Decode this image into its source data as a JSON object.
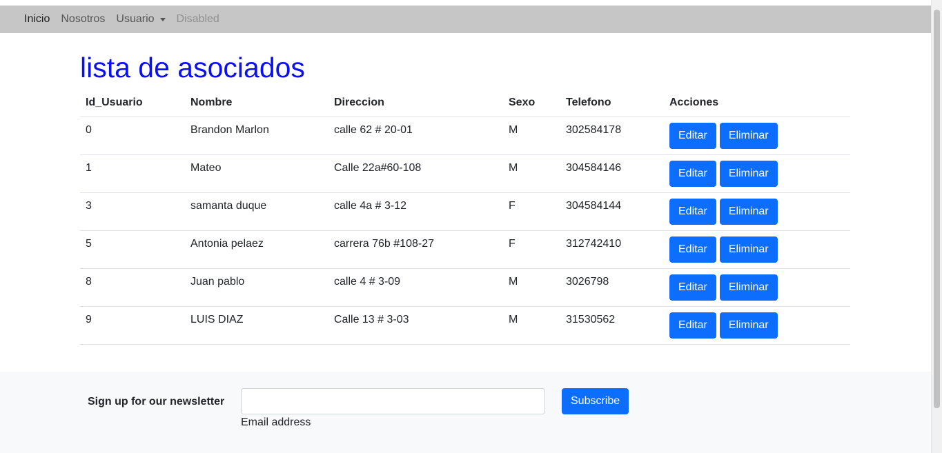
{
  "nav": {
    "items": [
      {
        "label": "Inicio"
      },
      {
        "label": "Nosotros"
      },
      {
        "label": "Usuario"
      },
      {
        "label": "Disabled"
      }
    ]
  },
  "page": {
    "title": "lista de asociados"
  },
  "table": {
    "headers": [
      "Id_Usuario",
      "Nombre",
      "Direccion",
      "Sexo",
      "Telefono",
      "Acciones"
    ],
    "edit_label": "Editar",
    "delete_label": "Eliminar",
    "rows": [
      {
        "id": "0",
        "nombre": "Brandon Marlon",
        "direccion": "calle 62 # 20-01",
        "sexo": "M",
        "telefono": "302584178"
      },
      {
        "id": "1",
        "nombre": "Mateo",
        "direccion": "Calle 22a#60-108",
        "sexo": "M",
        "telefono": "304584146"
      },
      {
        "id": "3",
        "nombre": "samanta duque",
        "direccion": "calle 4a # 3-12",
        "sexo": "F",
        "telefono": "304584144"
      },
      {
        "id": "5",
        "nombre": "Antonia pelaez",
        "direccion": "carrera 76b #108-27",
        "sexo": "F",
        "telefono": "312742410"
      },
      {
        "id": "8",
        "nombre": "Juan pablo",
        "direccion": "calle 4 # 3-09",
        "sexo": "M",
        "telefono": "3026798"
      },
      {
        "id": "9",
        "nombre": "LUIS DIAZ",
        "direccion": "Calle 13 # 3-03",
        "sexo": "M",
        "telefono": "31530562"
      }
    ]
  },
  "newsletter": {
    "label": "Sign up for our newsletter",
    "email_value": "",
    "help": "Email address",
    "subscribe_label": "Subscribe"
  },
  "colors": {
    "title": "#0b10f0",
    "primary": "#0d6efd",
    "navbar_bg": "#c6c6c6",
    "footer_bg": "#f8f9fa"
  }
}
